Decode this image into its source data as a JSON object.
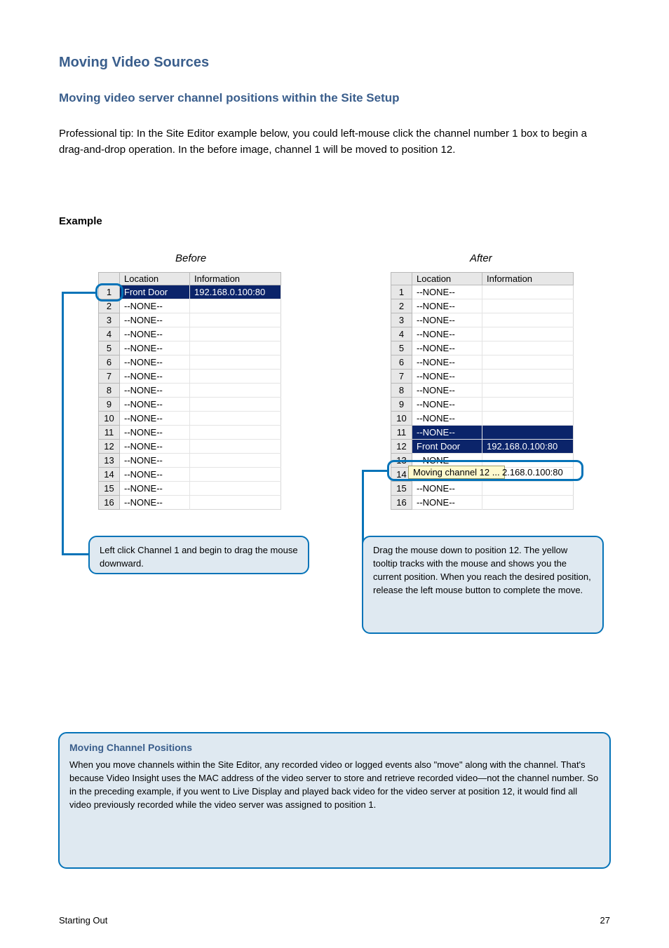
{
  "titles": {
    "main": "Moving Video Sources",
    "sub": "Moving video server channel positions within the Site Setup"
  },
  "intro": {
    "p1": "Professional tip: In the Site Editor example below, you could left-mouse click the channel number 1 box to begin a drag-and-drop operation. In the before image, channel 1 will be moved to position 12."
  },
  "example": {
    "before_label": "Before",
    "after_label": "After"
  },
  "table_headers": {
    "location": "Location",
    "information": "Information"
  },
  "none": "--NONE--",
  "row1": {
    "location": "Front Door",
    "info": "192.168.0.100:80"
  },
  "row12_after": {
    "location": "Front Door",
    "info": "192.168.0.100:80"
  },
  "drag_tooltip": "Moving channel 12 ...",
  "peek_ip": "2.168.0.100:80",
  "callouts": {
    "left": "Left click Channel 1 and begin to drag the mouse downward.",
    "right": "Drag the mouse down to position 12. The yellow tooltip tracks with the mouse and shows you the current position. When you reach the desired position, release the left mouse button to complete the move.",
    "bottom_label": "Moving Channel Positions",
    "bottom": "When you move channels within the Site Editor, any recorded video or logged events also \"move\" along with the channel. That's because Video Insight uses the MAC address of the video server to store and retrieve recorded video—not the channel number. So in the preceding example, if you went to Live Display and played back video for the video server at position 12, it would find all video previously recorded while the video server was assigned to position 1."
  },
  "footer": {
    "left": "Starting Out",
    "right": "27"
  }
}
